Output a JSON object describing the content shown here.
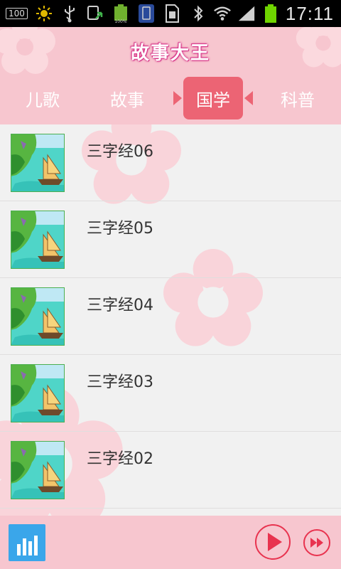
{
  "status_bar": {
    "battery_badge": "100",
    "time": "17:11"
  },
  "header": {
    "title": "故事大王"
  },
  "tabs": [
    {
      "label": "儿歌",
      "active": false
    },
    {
      "label": "故事",
      "active": false
    },
    {
      "label": "国学",
      "active": true
    },
    {
      "label": "科普",
      "active": false
    }
  ],
  "list": {
    "items": [
      {
        "title": "三字经06",
        "thumbnail_icon": "sailboat-cover-icon"
      },
      {
        "title": "三字经05",
        "thumbnail_icon": "sailboat-cover-icon"
      },
      {
        "title": "三字经04",
        "thumbnail_icon": "sailboat-cover-icon"
      },
      {
        "title": "三字经03",
        "thumbnail_icon": "sailboat-cover-icon"
      },
      {
        "title": "三字经02",
        "thumbnail_icon": "sailboat-cover-icon"
      }
    ]
  },
  "player": {
    "equalizer_icon": "equalizer-icon",
    "play_icon": "play-icon",
    "next_icon": "fast-forward-icon"
  },
  "colors": {
    "header_bg": "#f7c6cf",
    "active_tab": "#ec6474",
    "accent_red": "#e8334f",
    "eq_blue": "#3aa6ea"
  }
}
